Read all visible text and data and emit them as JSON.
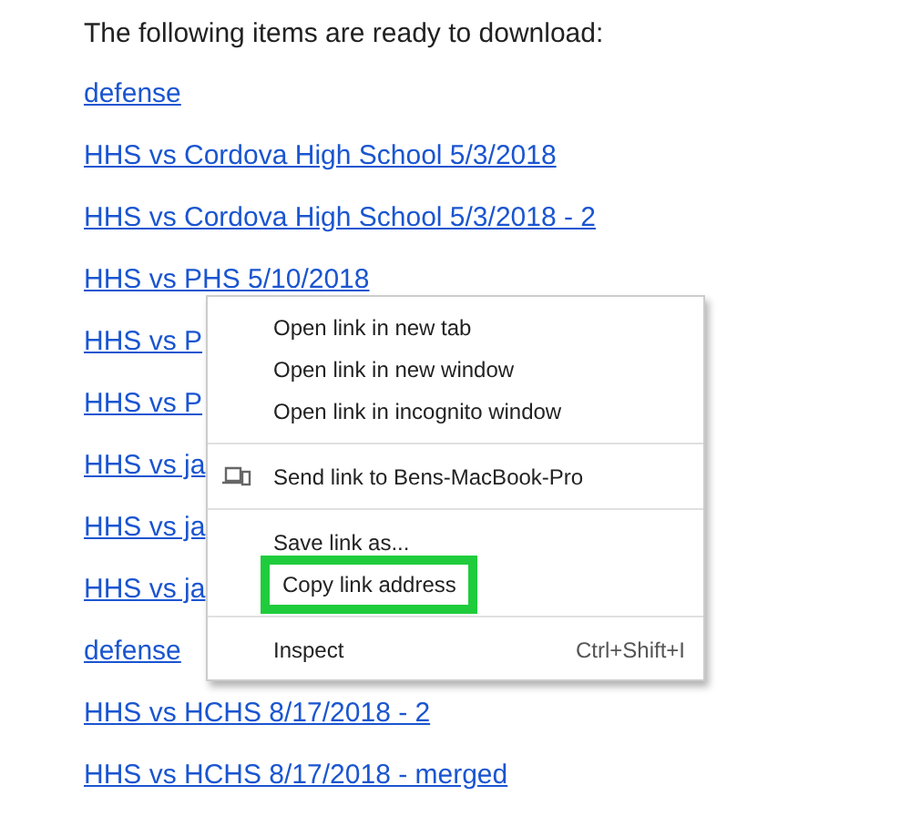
{
  "intro": "The following items are ready to download:",
  "links": [
    "defense",
    "HHS vs Cordova High School 5/3/2018",
    "HHS vs Cordova High School 5/3/2018 - 2",
    "HHS vs PHS 5/10/2018",
    "HHS vs P",
    "HHS vs P",
    "HHS vs ja",
    "HHS vs ja",
    "HHS vs ja",
    "defense",
    "HHS vs HCHS 8/17/2018 - 2",
    "HHS vs HCHS 8/17/2018 - merged"
  ],
  "context_menu": {
    "items": [
      {
        "kind": "item",
        "label": "Open link in new tab",
        "highlighted": false
      },
      {
        "kind": "item",
        "label": "Open link in new window",
        "highlighted": false
      },
      {
        "kind": "item",
        "label": "Open link in incognito window",
        "highlighted": false
      },
      {
        "kind": "separator"
      },
      {
        "kind": "device",
        "label": "Send link to Bens-MacBook-Pro",
        "highlighted": false
      },
      {
        "kind": "separator"
      },
      {
        "kind": "item",
        "label": "Save link as...",
        "highlighted": false
      },
      {
        "kind": "item",
        "label": "Copy link address",
        "highlighted": true
      },
      {
        "kind": "separator"
      },
      {
        "kind": "item",
        "label": "Inspect",
        "shortcut": "Ctrl+Shift+I",
        "highlighted": false
      }
    ]
  }
}
